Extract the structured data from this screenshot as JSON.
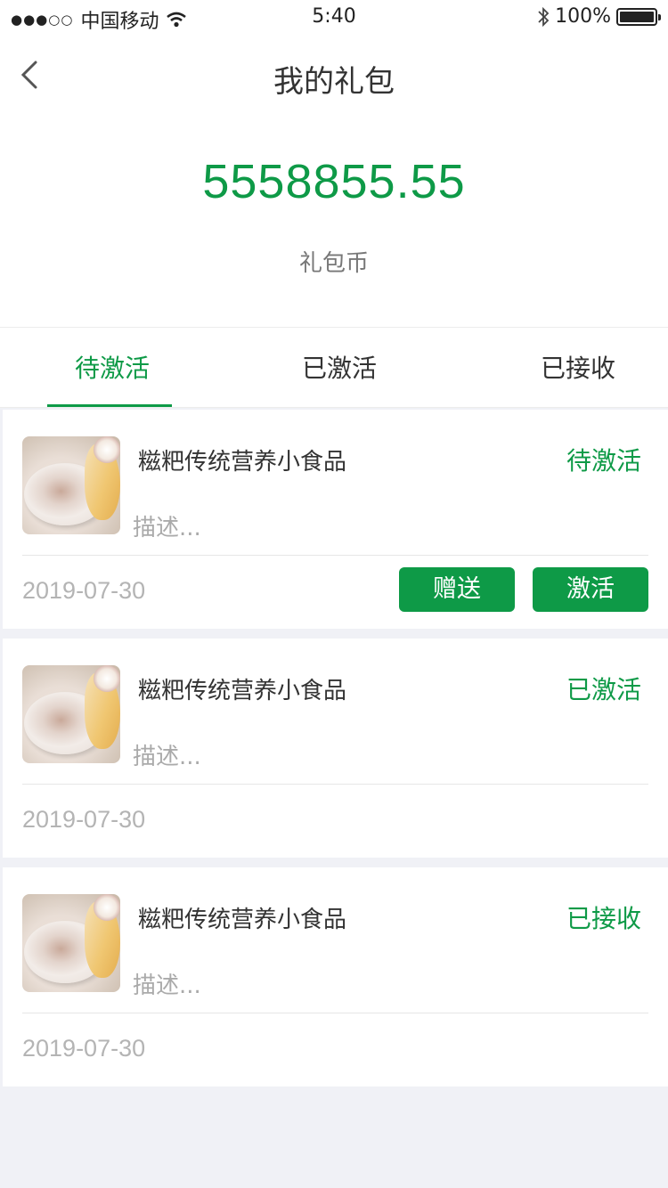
{
  "status_bar": {
    "signal": "●●●○○",
    "carrier": "中国移动",
    "wifi_icon": "wifi-icon",
    "time": "5:40",
    "bluetooth_icon": "bluetooth-icon",
    "battery_percent": "100%",
    "battery_icon": "battery-icon"
  },
  "nav": {
    "back_icon": "chevron-left-icon",
    "title": "我的礼包"
  },
  "balance": {
    "amount": "5558855.55",
    "unit": "礼包币"
  },
  "tabs": [
    {
      "label": "待激活",
      "active": true
    },
    {
      "label": "已激活",
      "active": false
    },
    {
      "label": "已接收",
      "active": false
    }
  ],
  "items": [
    {
      "name": "糍粑传统营养小食品",
      "desc": "描述...",
      "status": "待激活",
      "date": "2019-07-30",
      "actions": {
        "gift": "赠送",
        "activate": "激活"
      }
    },
    {
      "name": "糍粑传统营养小食品",
      "desc": "描述...",
      "status": "已激活",
      "date": "2019-07-30"
    },
    {
      "name": "糍粑传统营养小食品",
      "desc": "描述...",
      "status": "已接收",
      "date": "2019-07-30"
    }
  ],
  "colors": {
    "accent": "#0e9a47",
    "background": "#f0f1f6",
    "muted_text": "#b4b4b4"
  }
}
